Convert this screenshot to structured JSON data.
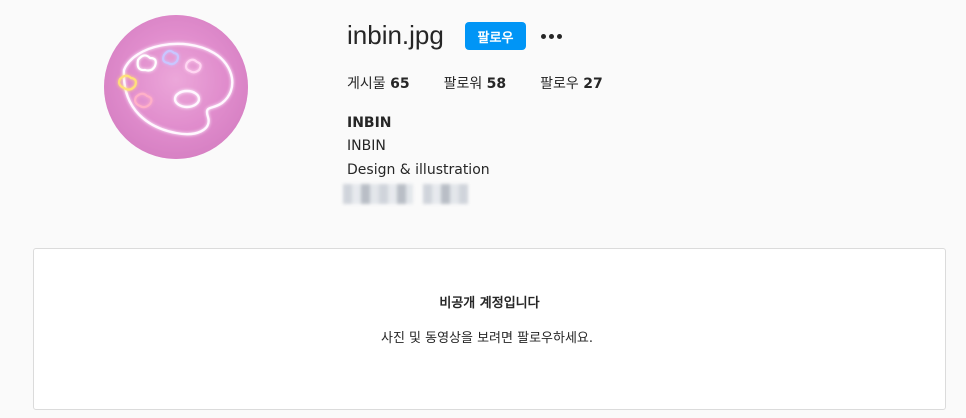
{
  "profile": {
    "username": "inbin.jpg",
    "follow_label": "팔로우",
    "stats": {
      "posts_label": "게시물",
      "posts_count": "65",
      "followers_label": "팔로워",
      "followers_count": "58",
      "following_label": "팔로우",
      "following_count": "27"
    },
    "full_name": "INBIN",
    "category": "INBIN",
    "bio": "Design & illustration"
  },
  "private": {
    "title": "비공개 계정입니다",
    "description": "사진 및 동영상을 보려면 팔로우하세요."
  },
  "colors": {
    "accent": "#0095f6",
    "background": "#fafafa",
    "text": "#262626",
    "border": "#dbdbdb"
  },
  "icons": {
    "more": "more-horizontal-icon",
    "avatar": "neon-palette-avatar"
  }
}
